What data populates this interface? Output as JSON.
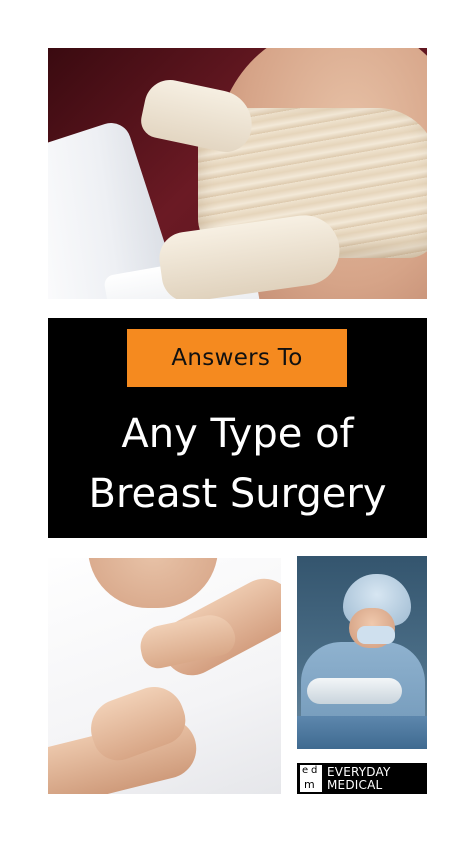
{
  "panel": {
    "badge_text": "Answers To",
    "headline_line1": "Any Type of",
    "headline_line2": "Breast Surgery"
  },
  "photos": {
    "top": "bandaged-chest-photo",
    "bottom_left": "self-exam-photo",
    "bottom_right": "surgeon-photo"
  },
  "logo": {
    "mark_letters": [
      "e",
      "d",
      "m"
    ],
    "line1": "EVERYDAY",
    "line2": "MEDICAL"
  },
  "colors": {
    "badge": "#f58a1f",
    "panel": "#000000",
    "headline": "#ffffff"
  }
}
